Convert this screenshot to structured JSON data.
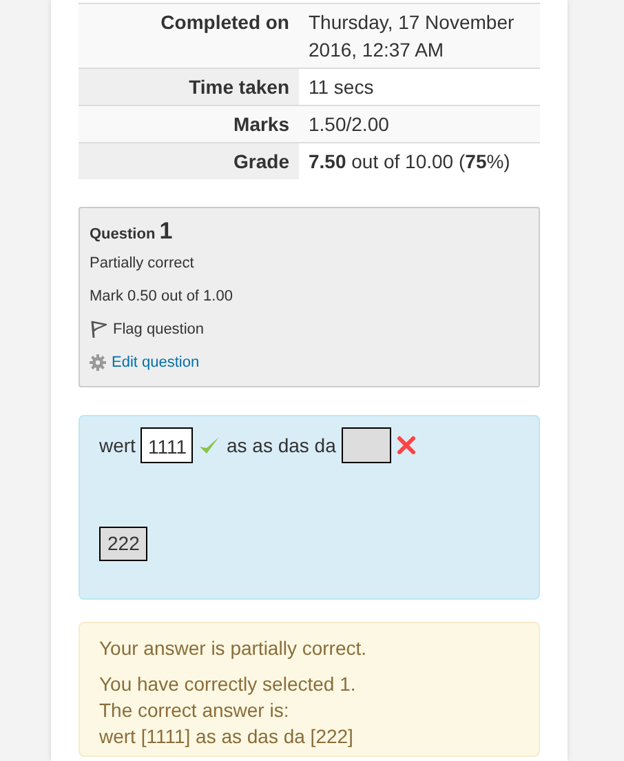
{
  "summary": [
    {
      "label": "Completed on",
      "value": "Thursday, 17 November 2016, 12:37 AM"
    },
    {
      "label": "Time taken",
      "value": "11 secs"
    },
    {
      "label": "Marks",
      "value": "1.50/2.00"
    },
    {
      "label": "Grade",
      "value": "**7.50** out of 10.00 (**75**%)"
    }
  ],
  "question": {
    "label": "Question",
    "number": "1",
    "state": "Partially correct",
    "mark": "Mark 0.50 out of 1.00",
    "flag": {
      "label": "Flag question",
      "flagged": false
    },
    "edit": "Edit question"
  },
  "formulation": {
    "items": [
      {
        "kind": "text",
        "text": "wert"
      },
      {
        "kind": "drop",
        "value": "1111"
      },
      {
        "kind": "mark",
        "correct": true
      },
      {
        "kind": "text",
        "text": "as as das da"
      },
      {
        "kind": "drop",
        "value": ""
      },
      {
        "kind": "mark",
        "correct": false
      }
    ],
    "choices": [
      "222"
    ]
  },
  "feedback": {
    "summary": "Your answer is partially correct.",
    "lines": [
      "You have correctly selected 1.",
      "The correct answer is:",
      "wert [1111] as as das da [222]"
    ]
  }
}
